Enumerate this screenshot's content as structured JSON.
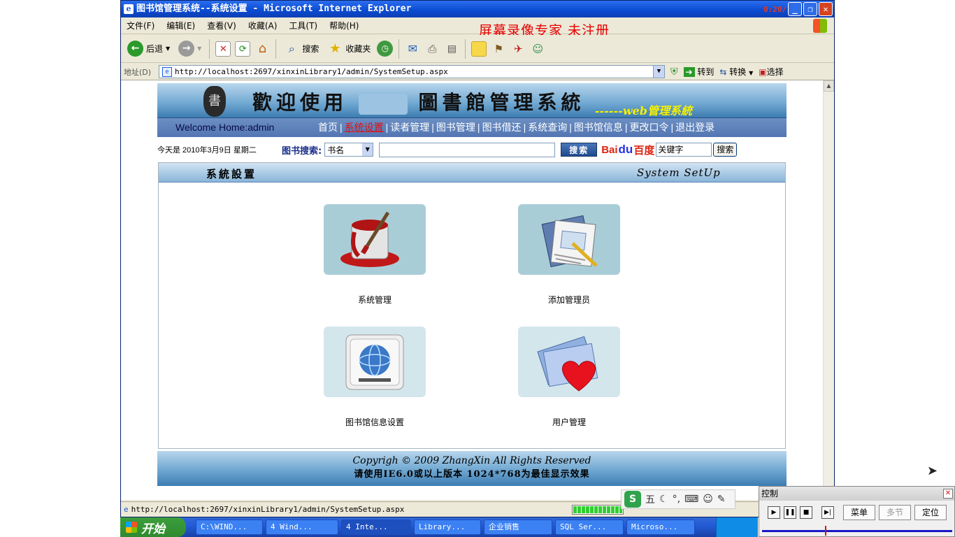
{
  "window": {
    "title": "图书馆管理系统--系统设置 - Microsoft Internet Explorer",
    "clock": "0:20/1:7"
  },
  "menubar": {
    "items": [
      "文件(F)",
      "编辑(E)",
      "查看(V)",
      "收藏(A)",
      "工具(T)",
      "帮助(H)"
    ],
    "watermark": "屏幕录像专家  未注册"
  },
  "toolbar": {
    "back": "后退",
    "search": "搜索",
    "favorites": "收藏夹"
  },
  "address": {
    "label": "地址(D)",
    "url": "http://localhost:2697/xinxinLibrary1/admin/SystemSetup.aspx",
    "go": "转到",
    "convert": "转换",
    "select": "选择"
  },
  "banner": {
    "seal": "書",
    "title_left": "歡迎使用",
    "title_right": "圖書館管理系統",
    "subtitle": "------web管理系統"
  },
  "nav": {
    "welcome": "Welcome Home:admin",
    "links": [
      "首页",
      "系统设置",
      "读者管理",
      "图书管理",
      "图书借还",
      "系统查询",
      "图书馆信息",
      "更改口令",
      "退出登录"
    ],
    "active_index": 1
  },
  "search": {
    "date": "今天是 2010年3月9日 星期二",
    "label": "图书搜索:",
    "field_selected": "书名",
    "button": "搜索",
    "baidu_left": "Bai",
    "baidu_paw": "du",
    "baidu_right": "百度",
    "baidu_value": "关键字",
    "baidu_button": "搜索"
  },
  "panel": {
    "title_cn": "系統設置",
    "title_en": "System  SetUp",
    "tiles": [
      {
        "label": "系统管理",
        "icon": "paint-bucket-icon"
      },
      {
        "label": "添加管理员",
        "icon": "documents-pen-icon"
      },
      {
        "label": "图书馆信息设置",
        "icon": "globe-monitor-icon"
      },
      {
        "label": "用户管理",
        "icon": "heart-folder-icon"
      }
    ]
  },
  "footer": {
    "line1": "Copyrigh © 2009 ZhangXin    All Rights Reserved",
    "line2": "请使用IE6.0或以上版本  1024*768为最佳显示效果"
  },
  "statusbar": {
    "url": "http://localhost:2697/xinxinLibrary1/admin/SystemSetup.aspx"
  },
  "ime": {
    "s": "S",
    "mode": "五"
  },
  "taskbar": {
    "start": "开始",
    "tasks": [
      "C:\\WIND...",
      "4 Wind...",
      "4 Inte...",
      "Library...",
      "企业销售",
      "SQL Ser...",
      "Microso..."
    ],
    "active_index": 2
  },
  "control": {
    "title": "控制",
    "menu": "菜单",
    "multi": "多节",
    "locate": "定位"
  },
  "colors": {
    "title_blue": "#0a4ad0",
    "nav_blue": "#5376b3",
    "active_red": "#e01010",
    "watermark_red": "#e80000"
  }
}
